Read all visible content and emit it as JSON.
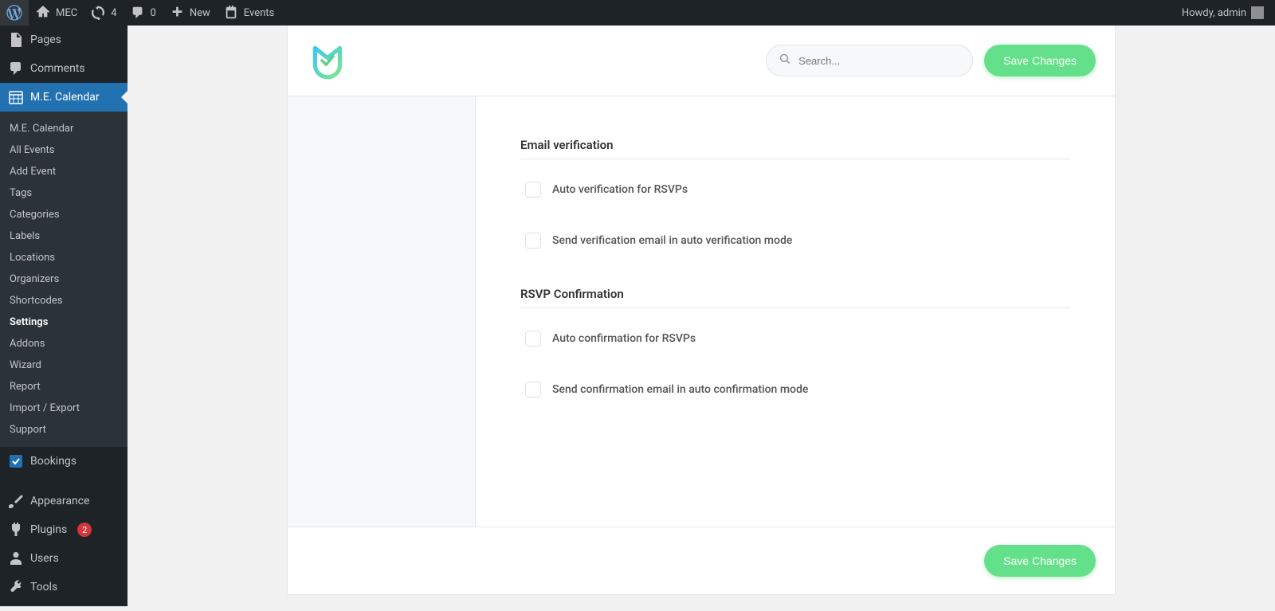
{
  "topbar": {
    "site_name": "MEC",
    "updates_count": "4",
    "comments_count": "0",
    "new_label": "New",
    "events_label": "Events",
    "howdy": "Howdy, admin"
  },
  "sidebar": {
    "main_items": {
      "pages": "Pages",
      "comments": "Comments",
      "me_calendar": "M.E. Calendar",
      "bookings": "Bookings",
      "appearance": "Appearance",
      "plugins": "Plugins",
      "users": "Users",
      "tools": "Tools"
    },
    "plugins_count": "2",
    "submenu": [
      "M.E. Calendar",
      "All Events",
      "Add Event",
      "Tags",
      "Categories",
      "Labels",
      "Locations",
      "Organizers",
      "Shortcodes",
      "Settings",
      "Addons",
      "Wizard",
      "Report",
      "Import / Export",
      "Support"
    ]
  },
  "panel": {
    "search_placeholder": "Search...",
    "save_button": "Save Changes",
    "sections": {
      "email_verification": {
        "title": "Email verification",
        "opt1": "Auto verification for RSVPs",
        "opt2": "Send verification email in auto verification mode"
      },
      "rsvp_confirmation": {
        "title": "RSVP Confirmation",
        "opt1": "Auto confirmation for RSVPs",
        "opt2": "Send confirmation email in auto confirmation mode"
      }
    }
  }
}
